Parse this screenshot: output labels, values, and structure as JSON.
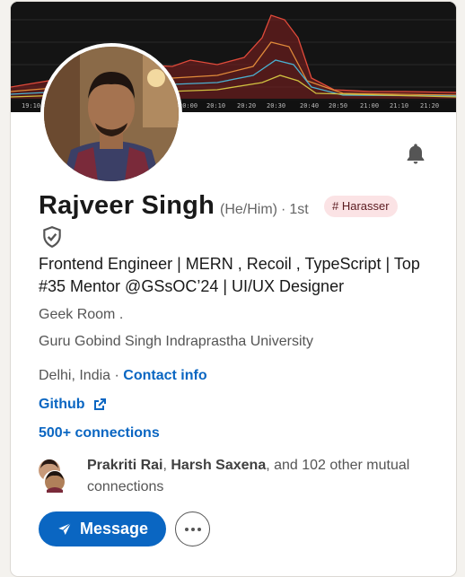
{
  "profile": {
    "name": "Rajveer Singh",
    "pronouns": "(He/Him)",
    "degree_separator": "·",
    "degree": "1st",
    "tag": "# Harasser",
    "headline": "Frontend Engineer | MERN , Recoil , TypeScript | Top #35 Mentor @GSsOC’24 | UI/UX Designer",
    "company": "Geek Room .",
    "school": "Guru Gobind Singh Indraprastha University",
    "location": "Delhi, India",
    "location_separator": "·",
    "contact_info": "Contact info",
    "github": "Github",
    "connections": "500+ connections"
  },
  "mutual": {
    "name1": "Prakriti Rai",
    "separator": ", ",
    "name2": "Harsh Saxena",
    "rest": ", and 102 other mutual connections"
  },
  "actions": {
    "message": "Message"
  },
  "banner": {
    "time_labels": [
      "19:10",
      "20:00",
      "20:10",
      "20:20",
      "20:30",
      "20:40",
      "20:50",
      "21:00",
      "21:10",
      "21:20"
    ]
  },
  "icons": {
    "bell": "bell-icon",
    "verify": "shield-check-icon",
    "external": "external-link-icon",
    "send": "send-icon",
    "more": "more-icon"
  },
  "colors": {
    "link": "#0a66c2",
    "tag_bg": "#fbe3e5",
    "banner_bg": "#141414"
  }
}
